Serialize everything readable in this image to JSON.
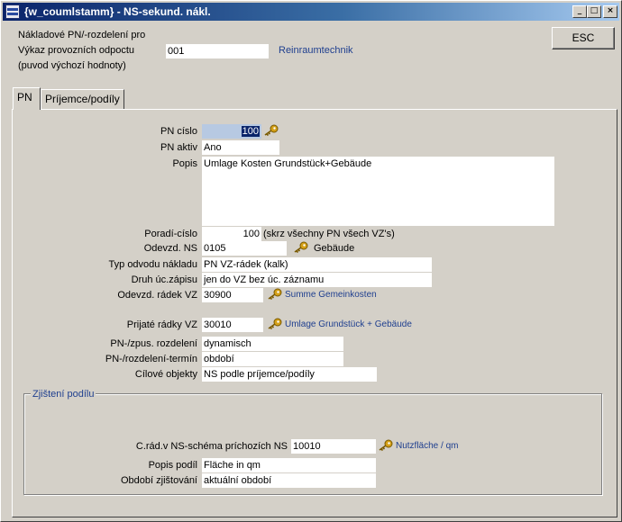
{
  "window": {
    "title": "{w_coumlstamm} - NS-sekund. nákl.",
    "min": "_",
    "max": "□",
    "close": "×"
  },
  "header": {
    "line1": "Nákladové PN/-rozdelení pro",
    "line2": "Výkaz provozních odpoctu",
    "line3": "(puvod  výchozí hodnoty)",
    "vykaz_value": "001",
    "vykaz_name": "Reinraumtechnik",
    "esc_label": "ESC"
  },
  "tabs": [
    {
      "label": "PN"
    },
    {
      "label": "Príjemce/podíly"
    }
  ],
  "form": {
    "pn_cislo": {
      "label": "PN císlo",
      "value": "100"
    },
    "pn_aktiv": {
      "label": "PN aktiv",
      "value": "Ano"
    },
    "popis": {
      "label": "Popis",
      "value": "Umlage Kosten Grundstück+Gebäude"
    },
    "poradi": {
      "label": "Poradí-císlo",
      "value": "100",
      "note": "(skrz všechny PN všech VZ's)"
    },
    "odevzd_ns": {
      "label": "Odevzd. NS",
      "value": "0105",
      "lookup": "Gebäude"
    },
    "typ_odvodu": {
      "label": "Typ odvodu nákladu",
      "value": "PN VZ-rádek (kalk)"
    },
    "druh_zapisu": {
      "label": "Druh úc.zápisu",
      "value": "jen do VZ bez úc. záznamu"
    },
    "odevzd_radek": {
      "label": "Odevzd. rádek VZ",
      "value": "30900",
      "lookup": "Summe Gemeinkosten"
    },
    "prijate_radky": {
      "label": "Prijaté rádky VZ",
      "value": "30010",
      "lookup": "Umlage Grundstück + Gebäude"
    },
    "zpus_rozdeleni": {
      "label": "PN-/zpus. rozdelení",
      "value": "dynamisch"
    },
    "rozdeleni_termin": {
      "label": "PN-/rozdelení-termín",
      "value": "období"
    },
    "cilove_objekty": {
      "label": "Cílové objekty",
      "value": "NS podle príjemce/podíly"
    }
  },
  "group": {
    "legend": "Zjištení podílu",
    "crad": {
      "label": "C.rád.v NS-schéma príchozích NS",
      "value": "10010",
      "lookup": "Nutzfläche / qm"
    },
    "popis_podil": {
      "label": "Popis podíl",
      "value": "Fläche in qm"
    },
    "obdobi": {
      "label": "Období zjištování",
      "value": "aktuální období"
    }
  },
  "colors": {
    "titlebar_start": "#0a246a",
    "titlebar_end": "#a6caf0",
    "link": "#1f3f8f",
    "key": "#d4a017"
  }
}
